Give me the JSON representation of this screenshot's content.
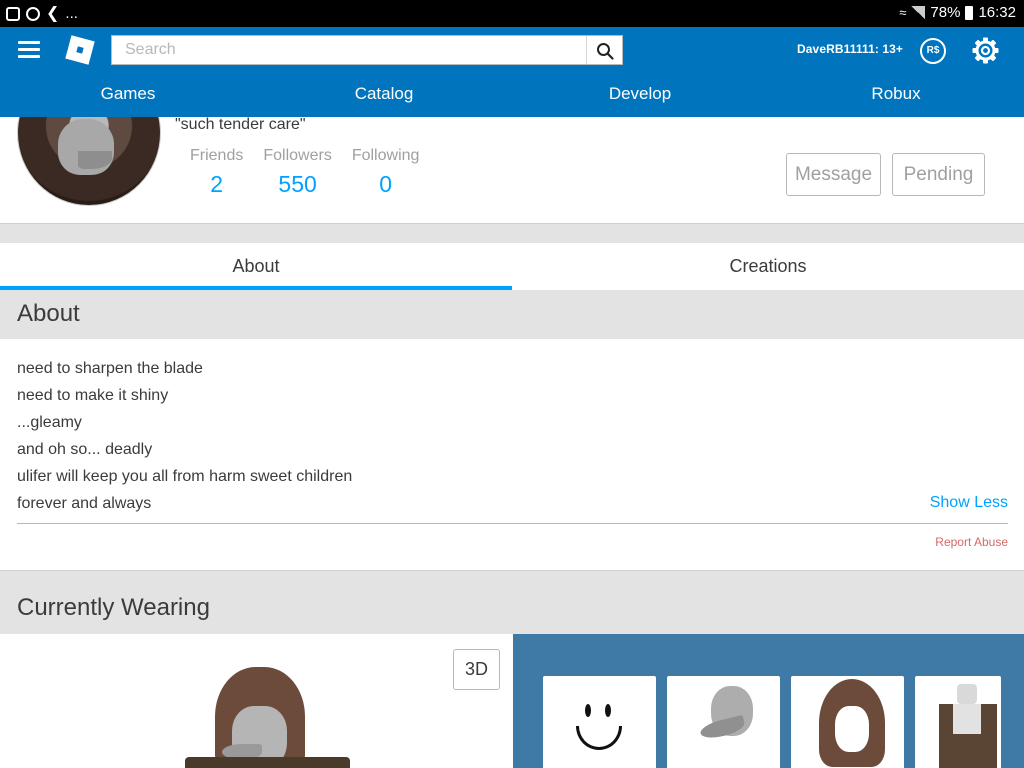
{
  "status_bar": {
    "left_ellipsis": "...",
    "battery": "78%",
    "time": "16:32"
  },
  "header": {
    "search_placeholder": "Search",
    "username": "DaveRB11111: 13+",
    "robux_label": "R$",
    "nav": [
      "Games",
      "Catalog",
      "Develop",
      "Robux"
    ]
  },
  "profile": {
    "status": "\"such tender care\"",
    "stats": [
      {
        "label": "Friends",
        "value": "2"
      },
      {
        "label": "Followers",
        "value": "550"
      },
      {
        "label": "Following",
        "value": "0"
      }
    ],
    "message_label": "Message",
    "pending_label": "Pending"
  },
  "tabs": [
    "About",
    "Creations"
  ],
  "about": {
    "heading": "About",
    "bio": [
      "need to sharpen the blade",
      "need to make it shiny",
      "...gleamy",
      "and oh so... deadly",
      "ulifer will keep you all from harm sweet children",
      "forever and always"
    ],
    "show_less": "Show Less",
    "report_abuse": "Report Abuse"
  },
  "wearing": {
    "heading": "Currently Wearing",
    "view_3d": "3D"
  },
  "colors": {
    "header_blue": "#0074bd",
    "accent_blue": "#00a2ff",
    "wearing_panel": "#3f7aa6",
    "report_red": "#d86868"
  }
}
